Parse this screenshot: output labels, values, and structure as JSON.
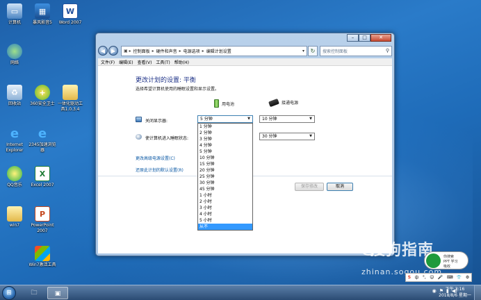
{
  "desktop": {
    "icons": [
      {
        "label": "计算机",
        "icon": "computer-icon"
      },
      {
        "label": "暴风影音5",
        "icon": "media-player-icon"
      },
      {
        "label": "Word 2007",
        "icon": "word-icon"
      },
      {
        "label": "网络",
        "icon": "network-icon"
      },
      {
        "label": "回收站",
        "icon": "recycle-bin-icon"
      },
      {
        "label": "360安全卫士",
        "icon": "security-guard-icon"
      },
      {
        "label": "一体化驱动工具1.0.3.4",
        "icon": "folder-icon"
      },
      {
        "label": "Internet Explorer",
        "icon": "ie-icon"
      },
      {
        "label": "2345加速浏览器",
        "icon": "browser-icon"
      },
      {
        "label": "QQ音乐",
        "icon": "music-icon"
      },
      {
        "label": "Excel 2007",
        "icon": "excel-icon"
      },
      {
        "label": "win7",
        "icon": "folder-icon"
      },
      {
        "label": "PowerPoint 2007",
        "icon": "powerpoint-icon"
      },
      {
        "label": "Win7激活工具",
        "icon": "windows-icon"
      }
    ]
  },
  "window": {
    "address": {
      "crumbs": [
        "控制面板",
        "硬件和声音",
        "电源选项",
        "编辑计划设置"
      ],
      "search_placeholder": "搜索控制面板"
    },
    "menu": [
      "文件(F)",
      "编辑(E)",
      "查看(V)",
      "工具(T)",
      "帮助(H)"
    ],
    "title": "更改计划的设置: 平衡",
    "subtitle": "选择希望计算机使用的睡眠设置和显示设置。",
    "col_battery": "用电池",
    "col_plugged": "接通电源",
    "rows": [
      {
        "label": "关闭显示器:",
        "battery": "5 分钟",
        "plugged": "10 分钟"
      },
      {
        "label": "使计算机进入睡眠状态:",
        "plugged": "30 分钟"
      }
    ],
    "links": {
      "advanced": "更改高级电源设置(C)",
      "restore": "还原此计划的默认设置(R)"
    },
    "buttons": {
      "save": "保存修改",
      "cancel": "取消"
    },
    "dropdown_options": [
      "1 分钟",
      "2 分钟",
      "3 分钟",
      "4 分钟",
      "5 分钟",
      "10 分钟",
      "15 分钟",
      "20 分钟",
      "25 分钟",
      "30 分钟",
      "45 分钟",
      "1 小时",
      "2 小时",
      "3 小时",
      "4 小时",
      "5 小时",
      "从不"
    ],
    "dropdown_selected": "从不"
  },
  "taskbar": {
    "clock_time": "下午 3:16",
    "clock_date": "2018/8/6 星期一"
  },
  "watermark": {
    "brand": "搜狗指南",
    "url": "zhinan.sogou.com"
  },
  "ime": {
    "line1": "你搜索",
    "line2": "PPT 学习",
    "line3": "吸收"
  }
}
